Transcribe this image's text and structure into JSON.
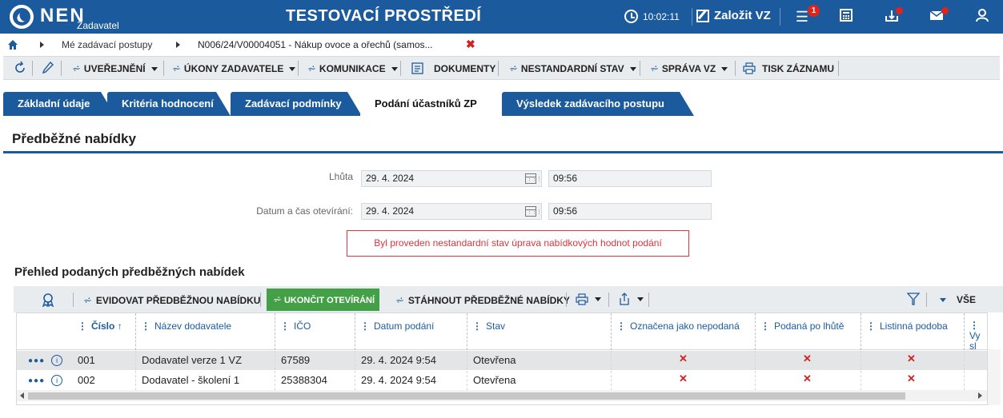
{
  "header": {
    "logo_text": "NEN",
    "logo_sub": "Zadavatel",
    "env_title": "TESTOVACÍ PROSTŘEDÍ",
    "clock": "10:02:11",
    "create_label": "Založit VZ",
    "notif_count": "1",
    "icons": [
      "clock-icon",
      "edit-icon",
      "menu-icon",
      "calculator-icon",
      "inbox-icon",
      "mail-icon",
      "user-icon"
    ]
  },
  "breadcrumb": {
    "items": [
      "Mé zadávací postupy",
      "N006/24/V00004051 - Nákup ovoce a ořechů (samos..."
    ],
    "close": "✖"
  },
  "toolbar": {
    "items": [
      {
        "label": "UVEŘEJNĚNÍ"
      },
      {
        "label": "ÚKONY ZADAVATELE"
      },
      {
        "label": "KOMUNIKACE"
      },
      {
        "label": "DOKUMENTY"
      },
      {
        "label": "NESTANDARDNÍ STAV"
      },
      {
        "label": "SPRÁVA VZ"
      },
      {
        "label": "TISK ZÁZNAMU"
      }
    ]
  },
  "tabs": [
    "Základní údaje",
    "Kritéria hodnocení",
    "Zadávací podmínky",
    "Podání účastníků ZP",
    "Výsledek zadávacího postupu"
  ],
  "active_tab": "Podání účastníků ZP",
  "section_title": "Předběžné nabídky",
  "form": {
    "deadline_label": "Lhůta",
    "deadline_date": "29. 4. 2024",
    "deadline_time": "09:56",
    "opening_label": "Datum a čas otevírání:",
    "opening_date": "29. 4. 2024",
    "opening_time": "09:56"
  },
  "alert_text": "Byl proveden nestandardní stav úprava nabídkových hodnot podání",
  "grid_title": "Přehled podaných předběžných nabídek",
  "grid_toolbar": {
    "record_label": "EVIDOVAT PŘEDBĚŽNOU NABÍDKU",
    "finish_label": "UKONČIT OTEVÍRÁNÍ",
    "download_label": "STÁHNOUT PŘEDBĚŽNÉ NABÍDKY",
    "all_label": "VŠE"
  },
  "columns": [
    "Číslo",
    "Název dodavatele",
    "IČO",
    "Datum podání",
    "Stav",
    "Označena jako nepodaná",
    "Podaná po lhůtě",
    "Listinná podoba",
    "Vy sl"
  ],
  "rows": [
    {
      "cislo": "001",
      "nazev": "Dodavatel verze 1 VZ",
      "ico": "67589",
      "datum": "29. 4. 2024 9:54",
      "stav": "Otevřena",
      "x": "✕"
    },
    {
      "cislo": "002",
      "nazev": "Dodavatel - školení 1",
      "ico": "25388304",
      "datum": "29. 4. 2024 9:54",
      "stav": "Otevřena",
      "x": "✕"
    }
  ],
  "colors": {
    "brand": "#1c5a9e",
    "green": "#43a047",
    "alert": "#d9363e"
  }
}
